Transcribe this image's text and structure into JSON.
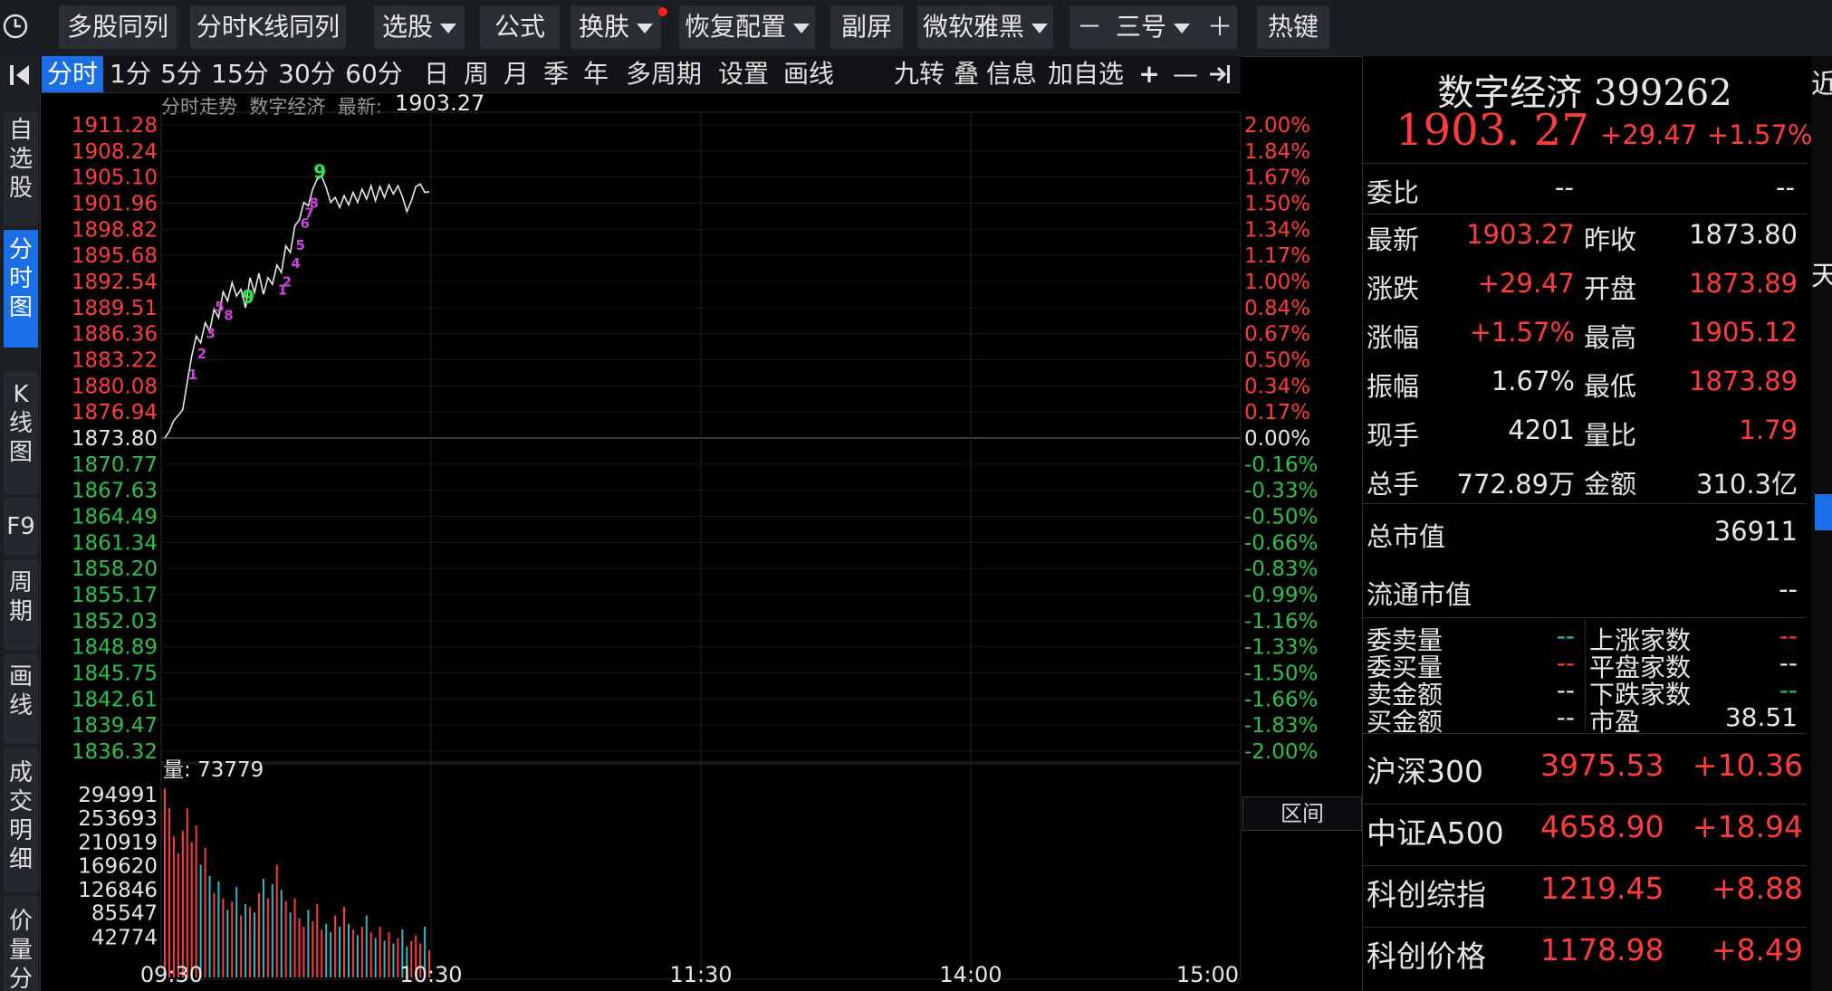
{
  "toolbar": {
    "items": [
      {
        "label": "多股同列"
      },
      {
        "label": "分时K线同列"
      },
      {
        "label": "选股"
      },
      {
        "label": "公式"
      },
      {
        "label": "换肤"
      },
      {
        "label": "恢复配置"
      },
      {
        "label": "副屏"
      },
      {
        "label": "微软雅黑"
      },
      {
        "label": "－"
      },
      {
        "label": "三号"
      },
      {
        "label": "＋"
      },
      {
        "label": "热键"
      }
    ],
    "colors": {
      "bg": "#1a1d22",
      "button": "#2b2e34",
      "accent": "#1a6ee6",
      "notify": "#ff2020"
    }
  },
  "sidebar": {
    "items": [
      {
        "label": "自选股"
      },
      {
        "label": "分时图"
      },
      {
        "label": "K线图"
      },
      {
        "label": "F9"
      },
      {
        "label": "周期"
      },
      {
        "label": "画线"
      },
      {
        "label": "成交明细"
      },
      {
        "label": "价量分"
      }
    ]
  },
  "tabs": {
    "items": [
      {
        "label": "分时"
      },
      {
        "label": "1分"
      },
      {
        "label": "5分"
      },
      {
        "label": "15分"
      },
      {
        "label": "30分"
      },
      {
        "label": "60分"
      },
      {
        "label": "日"
      },
      {
        "label": "周"
      },
      {
        "label": "月"
      },
      {
        "label": "季"
      },
      {
        "label": "年"
      },
      {
        "label": "多周期"
      },
      {
        "label": "设置"
      },
      {
        "label": "画线"
      }
    ],
    "right": [
      {
        "label": "九转"
      },
      {
        "label": "叠"
      },
      {
        "label": "信息"
      },
      {
        "label": "加自选"
      },
      {
        "label": "+"
      },
      {
        "label": "—"
      }
    ]
  },
  "chart_header": {
    "title": "分时走势",
    "name": "数字经济",
    "latest_label": "最新:",
    "latest_value": "1903.27"
  },
  "chart_data": {
    "type": "line",
    "price_ticks": [
      "1911.28",
      "1908.24",
      "1905.10",
      "1901.96",
      "1898.82",
      "1895.68",
      "1892.54",
      "1889.51",
      "1886.36",
      "1883.22",
      "1880.08",
      "1876.94",
      "1873.80",
      "1870.77",
      "1867.63",
      "1864.49",
      "1861.34",
      "1858.20",
      "1855.17",
      "1852.03",
      "1848.89",
      "1845.75",
      "1842.61",
      "1839.47",
      "1836.32"
    ],
    "pct_ticks": [
      "2.00%",
      "1.84%",
      "1.67%",
      "1.50%",
      "1.34%",
      "1.17%",
      "1.00%",
      "0.84%",
      "0.67%",
      "0.50%",
      "0.34%",
      "0.17%",
      "0.00%",
      "-0.16%",
      "-0.33%",
      "-0.50%",
      "-0.66%",
      "-0.83%",
      "-0.99%",
      "-1.16%",
      "-1.33%",
      "-1.50%",
      "-1.66%",
      "-1.83%",
      "-2.00%"
    ],
    "ylim": [
      1836.32,
      1911.28
    ],
    "prev_close": 1873.8,
    "time_ticks": [
      "09:30",
      "10:30",
      "11:30",
      "14:00",
      "15:00"
    ],
    "session_minutes": 240,
    "price_series": [
      {
        "t": 0,
        "v": 1873.8
      },
      {
        "t": 1,
        "v": 1874.6
      },
      {
        "t": 2,
        "v": 1875.9
      },
      {
        "t": 3,
        "v": 1876.5
      },
      {
        "t": 4,
        "v": 1877.2
      },
      {
        "t": 5,
        "v": 1880.5
      },
      {
        "t": 6,
        "v": 1883.6
      },
      {
        "t": 7,
        "v": 1886.0
      },
      {
        "t": 8,
        "v": 1885.2
      },
      {
        "t": 9,
        "v": 1887.6
      },
      {
        "t": 10,
        "v": 1886.6
      },
      {
        "t": 11,
        "v": 1889.2
      },
      {
        "t": 12,
        "v": 1888.2
      },
      {
        "t": 13,
        "v": 1891.3
      },
      {
        "t": 14,
        "v": 1890.2
      },
      {
        "t": 15,
        "v": 1892.4
      },
      {
        "t": 16,
        "v": 1890.8
      },
      {
        "t": 17,
        "v": 1891.6
      },
      {
        "t": 18,
        "v": 1889.4
      },
      {
        "t": 19,
        "v": 1893.0
      },
      {
        "t": 20,
        "v": 1891.2
      },
      {
        "t": 21,
        "v": 1893.5
      },
      {
        "t": 22,
        "v": 1891.0
      },
      {
        "t": 23,
        "v": 1893.0
      },
      {
        "t": 24,
        "v": 1892.2
      },
      {
        "t": 25,
        "v": 1894.5
      },
      {
        "t": 26,
        "v": 1893.6
      },
      {
        "t": 27,
        "v": 1896.8
      },
      {
        "t": 28,
        "v": 1896.0
      },
      {
        "t": 29,
        "v": 1899.2
      },
      {
        "t": 30,
        "v": 1899.9
      },
      {
        "t": 31,
        "v": 1902.0
      },
      {
        "t": 32,
        "v": 1901.6
      },
      {
        "t": 33,
        "v": 1903.6
      },
      {
        "t": 34,
        "v": 1904.8
      },
      {
        "t": 35,
        "v": 1905.1
      },
      {
        "t": 36,
        "v": 1903.8
      },
      {
        "t": 37,
        "v": 1902.0
      },
      {
        "t": 38,
        "v": 1902.6
      },
      {
        "t": 39,
        "v": 1901.4
      },
      {
        "t": 40,
        "v": 1902.8
      },
      {
        "t": 41,
        "v": 1901.7
      },
      {
        "t": 42,
        "v": 1903.2
      },
      {
        "t": 43,
        "v": 1902.0
      },
      {
        "t": 44,
        "v": 1903.6
      },
      {
        "t": 45,
        "v": 1902.4
      },
      {
        "t": 46,
        "v": 1904.0
      },
      {
        "t": 47,
        "v": 1902.2
      },
      {
        "t": 48,
        "v": 1903.9
      },
      {
        "t": 49,
        "v": 1902.6
      },
      {
        "t": 50,
        "v": 1904.1
      },
      {
        "t": 51,
        "v": 1903.0
      },
      {
        "t": 52,
        "v": 1904.0
      },
      {
        "t": 53,
        "v": 1902.7
      },
      {
        "t": 54,
        "v": 1900.9
      },
      {
        "t": 55,
        "v": 1902.2
      },
      {
        "t": 56,
        "v": 1903.9
      },
      {
        "t": 57,
        "v": 1904.2
      },
      {
        "t": 58,
        "v": 1903.2
      },
      {
        "t": 59,
        "v": 1903.27
      }
    ],
    "nine_turn_marks": [
      {
        "t": 6,
        "v": 1881.5,
        "label": "1",
        "color": "#d040e0"
      },
      {
        "t": 8,
        "v": 1884.0,
        "label": "2",
        "color": "#d040e0"
      },
      {
        "t": 10,
        "v": 1886.4,
        "label": "3",
        "color": "#d040e0"
      },
      {
        "t": 12,
        "v": 1889.6,
        "label": "5",
        "color": "#d040e0"
      },
      {
        "t": 14,
        "v": 1888.6,
        "label": "8",
        "color": "#d040e0"
      },
      {
        "t": 18,
        "v": 1890.6,
        "label": "9",
        "color": "#2be84a"
      },
      {
        "t": 26,
        "v": 1891.6,
        "label": "1",
        "color": "#d040e0"
      },
      {
        "t": 27,
        "v": 1892.6,
        "label": "2",
        "color": "#d040e0"
      },
      {
        "t": 29,
        "v": 1894.8,
        "label": "4",
        "color": "#d040e0"
      },
      {
        "t": 30,
        "v": 1897.0,
        "label": "5",
        "color": "#d040e0"
      },
      {
        "t": 31,
        "v": 1899.6,
        "label": "6",
        "color": "#d040e0"
      },
      {
        "t": 32,
        "v": 1900.8,
        "label": "7",
        "color": "#d040e0"
      },
      {
        "t": 33,
        "v": 1902.0,
        "label": "8",
        "color": "#d040e0"
      },
      {
        "t": 34,
        "v": 1905.6,
        "label": "9",
        "color": "#2be84a"
      }
    ],
    "volume_label": "量:",
    "volume_value": "73779",
    "volume_ticks": [
      "294991",
      "253693",
      "210919",
      "169620",
      "126846",
      "85547",
      "42774"
    ],
    "volume_max": 337000,
    "volume": [
      335000,
      300000,
      250000,
      220000,
      260000,
      300000,
      240000,
      270000,
      200000,
      230000,
      180000,
      150000,
      170000,
      140000,
      120000,
      135000,
      160000,
      110000,
      130000,
      125000,
      115000,
      150000,
      175000,
      140000,
      165000,
      200000,
      155000,
      135000,
      115000,
      140000,
      105000,
      90000,
      120000,
      100000,
      130000,
      85000,
      95000,
      80000,
      110000,
      90000,
      125000,
      95000,
      85000,
      75000,
      90000,
      110000,
      80000,
      70000,
      90000,
      65000,
      80000,
      60000,
      70000,
      85000,
      55000,
      65000,
      75000,
      60000,
      90000,
      48000
    ],
    "volume_colors": {
      "up": "#ff3b3b",
      "down": "#2fb9c8"
    },
    "range_button": "区间"
  },
  "quote": {
    "name": "数字经济",
    "code": "399262",
    "price": "1903. 27",
    "change": "+29.47",
    "change_pct": "+1.57%",
    "weibi_label": "委比",
    "weibi_v1": "--",
    "weibi_v2": "--",
    "rows": [
      {
        "l1": "最新",
        "v1": "1903.27",
        "l2": "昨收",
        "v2": "1873.80"
      },
      {
        "l1": "涨跌",
        "v1": "+29.47",
        "l2": "开盘",
        "v2": "1873.89"
      },
      {
        "l1": "涨幅",
        "v1": "+1.57%",
        "l2": "最高",
        "v2": "1905.12"
      },
      {
        "l1": "振幅",
        "v1": "1.67%",
        "l2": "最低",
        "v2": "1873.89"
      },
      {
        "l1": "现手",
        "v1": "4201",
        "l2": "量比",
        "v2": "1.79"
      },
      {
        "l1": "总手",
        "v1": "772.89万",
        "l2": "金额",
        "v2": "310.3亿"
      }
    ],
    "total_cap_label": "总市值",
    "total_cap_value": "36911",
    "float_cap_label": "流通市值",
    "float_cap_value": "--",
    "small_rows": [
      {
        "l1": "委卖量",
        "v1": "--",
        "l2": "上涨家数",
        "v2": "--"
      },
      {
        "l1": "委买量",
        "v1": "--",
        "l2": "平盘家数",
        "v2": "--"
      },
      {
        "l1": "卖金额",
        "v1": "--",
        "l2": "下跌家数",
        "v2": "--"
      },
      {
        "l1": "买金额",
        "v1": "--",
        "l2": "市盈",
        "v2": "38.51"
      }
    ],
    "indices": [
      {
        "name": "沪深300",
        "price": "3975.53",
        "chg": "+10.36"
      },
      {
        "name": "中证A500",
        "price": "4658.90",
        "chg": "+18.94"
      },
      {
        "name": "科创综指",
        "price": "1219.45",
        "chg": "+8.88"
      },
      {
        "name": "科创价格",
        "price": "1178.98",
        "chg": "+8.49"
      }
    ]
  },
  "edge": {
    "text1": "近",
    "text2": "天"
  }
}
